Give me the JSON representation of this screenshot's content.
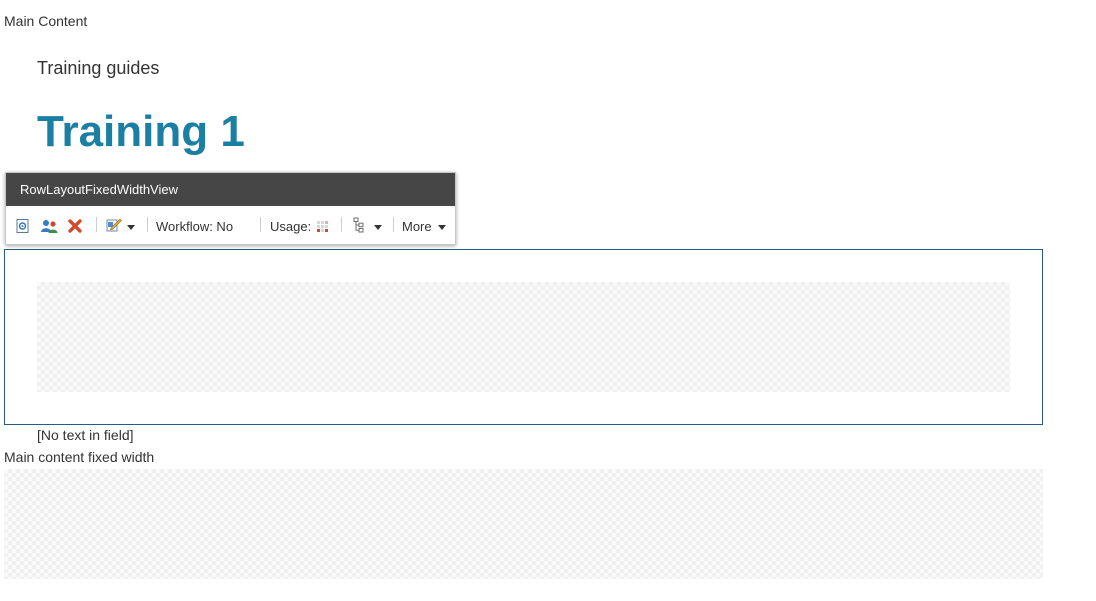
{
  "main_label": "Main Content",
  "breadcrumb": "Training guides",
  "page_title": "Training 1",
  "chrome": {
    "header_title": "RowLayoutFixedWidthView",
    "toolbar": {
      "workflow_label": "Workflow: No",
      "usage_label": "Usage:",
      "more_label": "More"
    },
    "icons": [
      "properties-icon",
      "personalize-icon",
      "remove-icon",
      "edit-variant-icon",
      "usage-grid-icon",
      "tree-structure-icon",
      "chevron-down-icon"
    ]
  },
  "placeholder": {
    "empty_field_text": "[No text in field]"
  },
  "fixed_width": {
    "label": "Main content fixed width"
  },
  "colors": {
    "title": "#1a7fa3",
    "chrome_header_bg": "#464646",
    "frame_border": "#2a5a83"
  }
}
